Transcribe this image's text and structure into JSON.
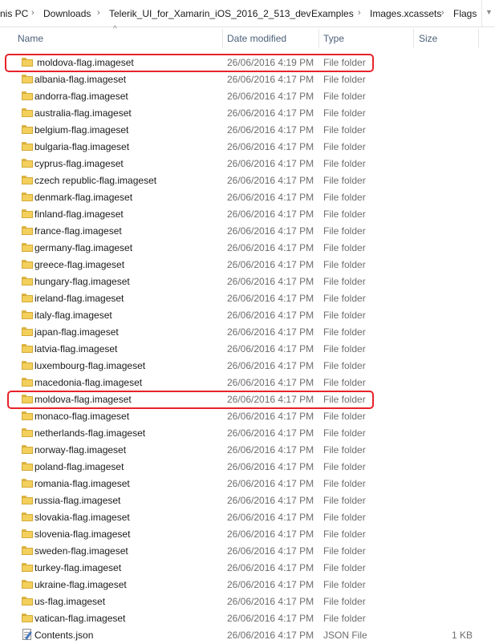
{
  "breadcrumb": {
    "segments": [
      "nis PC",
      "Downloads",
      "Telerik_UI_for_Xamarin_iOS_2016_2_513_dev",
      "Examples",
      "Images.xcassets",
      "Flags"
    ],
    "separator": "›"
  },
  "columns": {
    "name": "Name",
    "date_modified": "Date modified",
    "type": "Type",
    "size": "Size"
  },
  "files": [
    {
      "name": "moldova-flag.imageset",
      "date": "26/06/2016 4:19 PM",
      "type": "File folder",
      "size": "",
      "icon": "folder-icon",
      "highlighted": true
    },
    {
      "name": "albania-flag.imageset",
      "date": "26/06/2016 4:17 PM",
      "type": "File folder",
      "size": "",
      "icon": "folder-icon"
    },
    {
      "name": "andorra-flag.imageset",
      "date": "26/06/2016 4:17 PM",
      "type": "File folder",
      "size": "",
      "icon": "folder-icon"
    },
    {
      "name": "australia-flag.imageset",
      "date": "26/06/2016 4:17 PM",
      "type": "File folder",
      "size": "",
      "icon": "folder-icon"
    },
    {
      "name": "belgium-flag.imageset",
      "date": "26/06/2016 4:17 PM",
      "type": "File folder",
      "size": "",
      "icon": "folder-icon"
    },
    {
      "name": "bulgaria-flag.imageset",
      "date": "26/06/2016 4:17 PM",
      "type": "File folder",
      "size": "",
      "icon": "folder-icon"
    },
    {
      "name": "cyprus-flag.imageset",
      "date": "26/06/2016 4:17 PM",
      "type": "File folder",
      "size": "",
      "icon": "folder-icon"
    },
    {
      "name": "czech republic-flag.imageset",
      "date": "26/06/2016 4:17 PM",
      "type": "File folder",
      "size": "",
      "icon": "folder-icon"
    },
    {
      "name": "denmark-flag.imageset",
      "date": "26/06/2016 4:17 PM",
      "type": "File folder",
      "size": "",
      "icon": "folder-icon"
    },
    {
      "name": "finland-flag.imageset",
      "date": "26/06/2016 4:17 PM",
      "type": "File folder",
      "size": "",
      "icon": "folder-icon"
    },
    {
      "name": "france-flag.imageset",
      "date": "26/06/2016 4:17 PM",
      "type": "File folder",
      "size": "",
      "icon": "folder-icon"
    },
    {
      "name": "germany-flag.imageset",
      "date": "26/06/2016 4:17 PM",
      "type": "File folder",
      "size": "",
      "icon": "folder-icon"
    },
    {
      "name": "greece-flag.imageset",
      "date": "26/06/2016 4:17 PM",
      "type": "File folder",
      "size": "",
      "icon": "folder-icon"
    },
    {
      "name": "hungary-flag.imageset",
      "date": "26/06/2016 4:17 PM",
      "type": "File folder",
      "size": "",
      "icon": "folder-icon"
    },
    {
      "name": "ireland-flag.imageset",
      "date": "26/06/2016 4:17 PM",
      "type": "File folder",
      "size": "",
      "icon": "folder-icon"
    },
    {
      "name": "italy-flag.imageset",
      "date": "26/06/2016 4:17 PM",
      "type": "File folder",
      "size": "",
      "icon": "folder-icon"
    },
    {
      "name": "japan-flag.imageset",
      "date": "26/06/2016 4:17 PM",
      "type": "File folder",
      "size": "",
      "icon": "folder-icon"
    },
    {
      "name": "latvia-flag.imageset",
      "date": "26/06/2016 4:17 PM",
      "type": "File folder",
      "size": "",
      "icon": "folder-icon"
    },
    {
      "name": "luxembourg-flag.imageset",
      "date": "26/06/2016 4:17 PM",
      "type": "File folder",
      "size": "",
      "icon": "folder-icon"
    },
    {
      "name": "macedonia-flag.imageset",
      "date": "26/06/2016 4:17 PM",
      "type": "File folder",
      "size": "",
      "icon": "folder-icon"
    },
    {
      "name": "moldova-flag.imageset",
      "date": "26/06/2016 4:17 PM",
      "type": "File folder",
      "size": "",
      "icon": "folder-icon",
      "highlighted": true
    },
    {
      "name": "monaco-flag.imageset",
      "date": "26/06/2016 4:17 PM",
      "type": "File folder",
      "size": "",
      "icon": "folder-icon"
    },
    {
      "name": "netherlands-flag.imageset",
      "date": "26/06/2016 4:17 PM",
      "type": "File folder",
      "size": "",
      "icon": "folder-icon"
    },
    {
      "name": "norway-flag.imageset",
      "date": "26/06/2016 4:17 PM",
      "type": "File folder",
      "size": "",
      "icon": "folder-icon"
    },
    {
      "name": "poland-flag.imageset",
      "date": "26/06/2016 4:17 PM",
      "type": "File folder",
      "size": "",
      "icon": "folder-icon"
    },
    {
      "name": "romania-flag.imageset",
      "date": "26/06/2016 4:17 PM",
      "type": "File folder",
      "size": "",
      "icon": "folder-icon"
    },
    {
      "name": "russia-flag.imageset",
      "date": "26/06/2016 4:17 PM",
      "type": "File folder",
      "size": "",
      "icon": "folder-icon"
    },
    {
      "name": "slovakia-flag.imageset",
      "date": "26/06/2016 4:17 PM",
      "type": "File folder",
      "size": "",
      "icon": "folder-icon"
    },
    {
      "name": "slovenia-flag.imageset",
      "date": "26/06/2016 4:17 PM",
      "type": "File folder",
      "size": "",
      "icon": "folder-icon"
    },
    {
      "name": "sweden-flag.imageset",
      "date": "26/06/2016 4:17 PM",
      "type": "File folder",
      "size": "",
      "icon": "folder-icon"
    },
    {
      "name": "turkey-flag.imageset",
      "date": "26/06/2016 4:17 PM",
      "type": "File folder",
      "size": "",
      "icon": "folder-icon"
    },
    {
      "name": "ukraine-flag.imageset",
      "date": "26/06/2016 4:17 PM",
      "type": "File folder",
      "size": "",
      "icon": "folder-icon"
    },
    {
      "name": "us-flag.imageset",
      "date": "26/06/2016 4:17 PM",
      "type": "File folder",
      "size": "",
      "icon": "folder-icon"
    },
    {
      "name": "vatican-flag.imageset",
      "date": "26/06/2016 4:17 PM",
      "type": "File folder",
      "size": "",
      "icon": "folder-icon"
    },
    {
      "name": "Contents.json",
      "date": "26/06/2016 4:17 PM",
      "type": "JSON File",
      "size": "1 KB",
      "icon": "json-file-icon"
    }
  ],
  "colors": {
    "highlight_outline": "#e8222a",
    "header_text": "#4c607a",
    "folder": "#f3cf5c"
  }
}
